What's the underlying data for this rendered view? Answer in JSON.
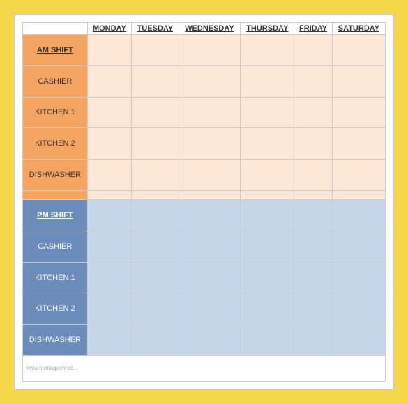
{
  "header": {
    "col0": "",
    "cols": [
      "MONDAY",
      "TUESDAY",
      "WEDNESDAY",
      "THURSDAY",
      "FRIDAY",
      "SATURDAY"
    ]
  },
  "am_section": {
    "shift_label": "AM SHIFT",
    "rows": [
      {
        "label": "CASHIER"
      },
      {
        "label": "KITCHEN 1"
      },
      {
        "label": "KITCHEN 2"
      },
      {
        "label": "DISHWASHER"
      },
      {
        "label": ""
      }
    ]
  },
  "pm_section": {
    "shift_label": "PM SHIFT",
    "rows": [
      {
        "label": "CASHIER"
      },
      {
        "label": "KITCHEN 1"
      },
      {
        "label": "KITCHEN 2"
      },
      {
        "label": "DISHWASHER"
      }
    ]
  },
  "watermark": "www.heritagechrist..."
}
